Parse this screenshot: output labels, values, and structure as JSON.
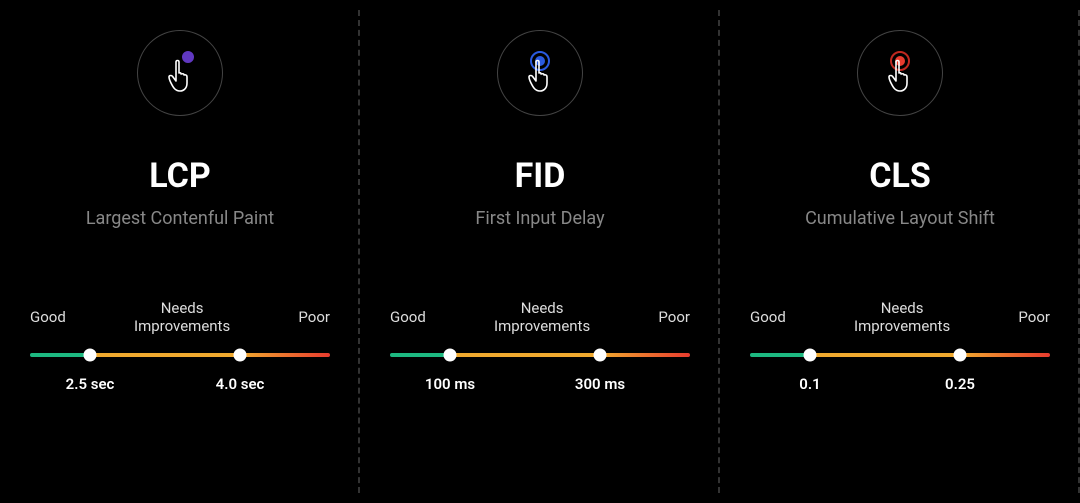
{
  "metrics": [
    {
      "key": "lcp",
      "title": "LCP",
      "subtitle": "Largest Contenful Paint",
      "labels": {
        "good": "Good",
        "mid": "Needs\nImprovements",
        "poor": "Poor"
      },
      "threshold1": "2.5 sec",
      "threshold2": "4.0 sec",
      "accent": "#6b3fd6",
      "marker1_pct": 20,
      "marker2_pct": 70,
      "seg_good_pct": 20,
      "seg_mid_pct": 50,
      "seg_poor_pct": 30
    },
    {
      "key": "fid",
      "title": "FID",
      "subtitle": "First Input Delay",
      "labels": {
        "good": "Good",
        "mid": "Needs\nImprovements",
        "poor": "Poor"
      },
      "threshold1": "100 ms",
      "threshold2": "300 ms",
      "accent": "#2a5ae0",
      "marker1_pct": 20,
      "marker2_pct": 70,
      "seg_good_pct": 20,
      "seg_mid_pct": 50,
      "seg_poor_pct": 30
    },
    {
      "key": "cls",
      "title": "CLS",
      "subtitle": "Cumulative Layout Shift",
      "labels": {
        "good": "Good",
        "mid": "Needs\nImprovements",
        "poor": "Poor"
      },
      "threshold1": "0.1",
      "threshold2": "0.25",
      "accent": "#e83b2e",
      "marker1_pct": 20,
      "marker2_pct": 70,
      "seg_good_pct": 20,
      "seg_mid_pct": 50,
      "seg_poor_pct": 30
    }
  ],
  "colors": {
    "good": "#1db981",
    "mid": "#f0a92e",
    "poor": "#e83b2e"
  }
}
